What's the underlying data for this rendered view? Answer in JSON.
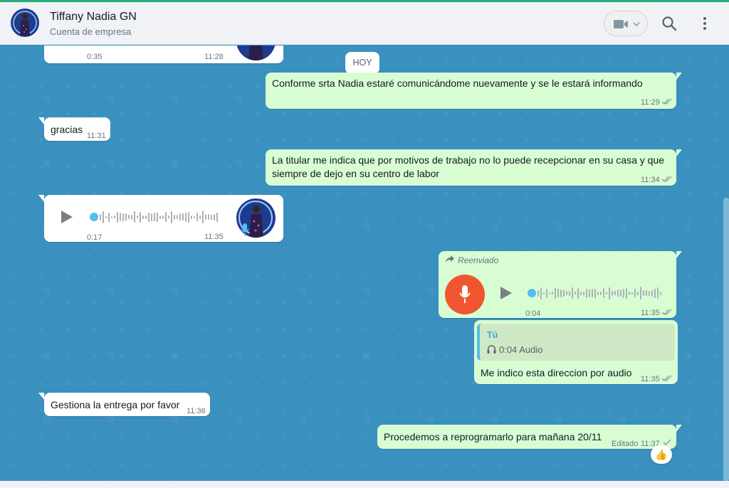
{
  "header": {
    "contact_name": "Tiffany Nadia GN",
    "contact_subtitle": "Cuenta de empresa",
    "icons": [
      "avatar",
      "video-camera-icon",
      "chevron-down-icon",
      "search-icon",
      "menu-dots-icon"
    ]
  },
  "day_separator": "HOY",
  "messages": {
    "m0": {
      "direction": "in",
      "type": "audio",
      "duration": "0:35",
      "time": "11:28"
    },
    "m1": {
      "direction": "out",
      "text": "Conforme srta Nadia estaré comunicándome nuevamente y se le estará informando",
      "time": "11:29",
      "status": "read"
    },
    "m2": {
      "direction": "in",
      "text": "gracias",
      "time": "11:31"
    },
    "m3": {
      "direction": "out",
      "text_line1": "La titular me indica que por motivos de trabajo no lo puede recepcionar en su casa y que",
      "text_line2": "siempre de dejo en su centro de labor",
      "time": "11:34",
      "status": "read"
    },
    "m4": {
      "direction": "in",
      "type": "audio",
      "duration": "0:17",
      "time": "11:35",
      "playback_progress": 0
    },
    "m5": {
      "direction": "out",
      "type": "audio",
      "forwarded_label": "Reenviado",
      "duration": "0:04",
      "time": "11:35",
      "status": "read",
      "playback_progress": 0
    },
    "m6": {
      "direction": "out",
      "quoted_author": "Tú",
      "quoted_content": "0:04 Audio",
      "text": "Me indico esta direccion por audio",
      "time": "11:35",
      "status": "read"
    },
    "m7": {
      "direction": "in",
      "text": "Gestiona la entrega por favor",
      "time": "11:36"
    },
    "m8": {
      "direction": "out",
      "text": "Procedemos a reprogramarlo para mañana 20/11",
      "edited_label": "Editado",
      "time": "11:37",
      "status": "sent",
      "reaction": "👍"
    }
  },
  "colors": {
    "chat_background": "#3a90bf",
    "incoming_bubble": "#ffffff",
    "outgoing_bubble": "#d9fdd3",
    "read_ticks": "#8696a0",
    "mic_badge": "#f0552f",
    "play_dot": "#53bdeb"
  }
}
